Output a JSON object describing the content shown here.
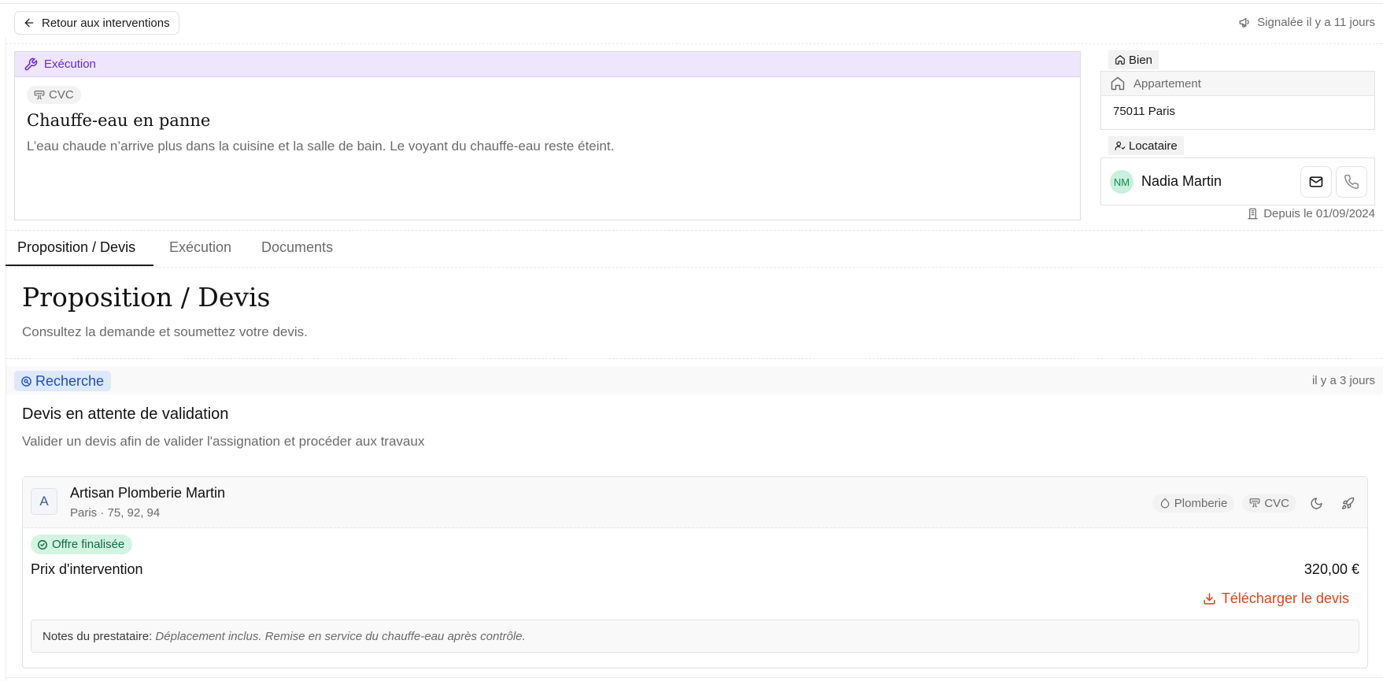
{
  "header": {
    "back_label": "Retour aux interventions",
    "reported_text": "Signalée il y a 11 jours"
  },
  "intervention": {
    "status_label": "Exécution",
    "category_tag": "CVC",
    "title": "Chauffe-eau en panne",
    "description": "L’eau chaude n’arrive plus dans la cuisine et la salle de bain. Le voyant du chauffe-eau reste éteint."
  },
  "property": {
    "section_label": "Bien",
    "type": "Appartement",
    "location": "75011 Paris"
  },
  "tenant": {
    "section_label": "Locataire",
    "initials": "NM",
    "name": "Nadia Martin",
    "since": "Depuis le 01/09/2024"
  },
  "tabs": [
    {
      "label": "Proposition / Devis",
      "active": true
    },
    {
      "label": "Exécution",
      "active": false
    },
    {
      "label": "Documents",
      "active": false
    }
  ],
  "section": {
    "title": "Proposition / Devis",
    "subtitle": "Consultez la demande et soumettez votre devis."
  },
  "search": {
    "status": "Recherche",
    "time": "il y a 3 jours",
    "title": "Devis en attente de validation",
    "subtitle": "Valider un devis afin de valider l'assignation et procéder aux travaux"
  },
  "provider": {
    "initial": "A",
    "name": "Artisan Plomberie Martin",
    "location": "Paris · 75, 92, 94",
    "tags": [
      "Plomberie",
      "CVC"
    ],
    "offer_status": "Offre finalisée",
    "price_label": "Prix d'intervention",
    "price_value": "320,00 €",
    "download_label": "Télécharger le devis",
    "notes_label": "Notes du prestataire:",
    "notes_value": "Déplacement inclus. Remise en service du chauffe-eau après contrôle."
  },
  "colors": {
    "execution_accent": "#6a27c9",
    "search_accent": "#1e4fb5",
    "offer_accent": "#0d6b3d",
    "download_accent": "#d7471a"
  },
  "icons": {
    "back": "arrow-left-icon",
    "reported": "megaphone-icon",
    "execution": "wrench-icon",
    "hvac": "air-vent-icon",
    "property": "home-icon",
    "tenant": "user-icon",
    "email": "mail-icon",
    "phone": "phone-icon",
    "since": "building-icon",
    "search": "search-circle-icon",
    "plumbing": "droplet-icon",
    "night": "moon-icon",
    "urgent": "rocket-icon",
    "offer": "check-circle-icon",
    "download": "download-icon"
  }
}
